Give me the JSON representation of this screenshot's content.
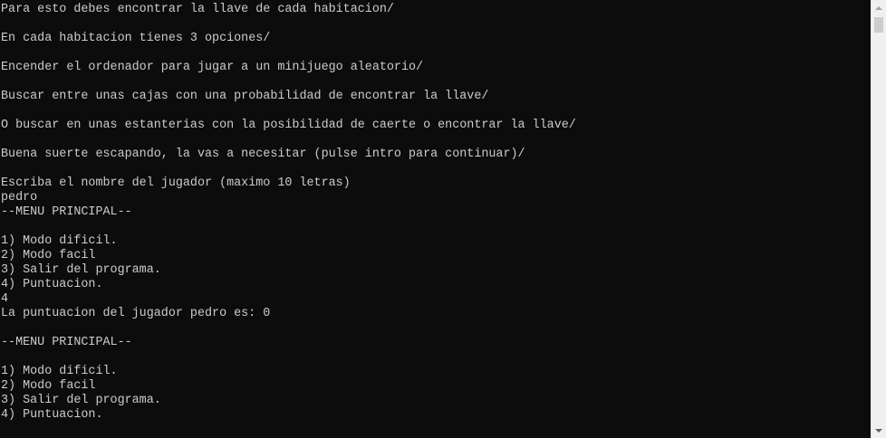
{
  "console": {
    "lines": [
      "Para esto debes encontrar la llave de cada habitacion/",
      "",
      "En cada habitacion tienes 3 opciones/",
      "",
      "Encender el ordenador para jugar a un minijuego aleatorio/",
      "",
      "Buscar entre unas cajas con una probabilidad de encontrar la llave/",
      "",
      "O buscar en unas estanterias con la posibilidad de caerte o encontrar la llave/",
      "",
      "Buena suerte escapando, la vas a necesitar (pulse intro para continuar)/",
      "",
      "Escriba el nombre del jugador (maximo 10 letras)",
      "pedro",
      "--MENU PRINCIPAL--",
      "",
      "1) Modo dificil.",
      "2) Modo facil",
      "3) Salir del programa.",
      "4) Puntuacion.",
      "4",
      "La puntuacion del jugador pedro es: 0",
      "",
      "--MENU PRINCIPAL--",
      "",
      "1) Modo dificil.",
      "2) Modo facil",
      "3) Salir del programa.",
      "4) Puntuacion."
    ]
  },
  "colors": {
    "background": "#0c0c0c",
    "foreground": "#cccccc",
    "scrollbar_track": "#f0f0f0",
    "scrollbar_thumb": "#cdcdcd"
  },
  "icons": {
    "scroll_up": "triangle-up-icon",
    "scroll_down": "triangle-down-icon"
  }
}
